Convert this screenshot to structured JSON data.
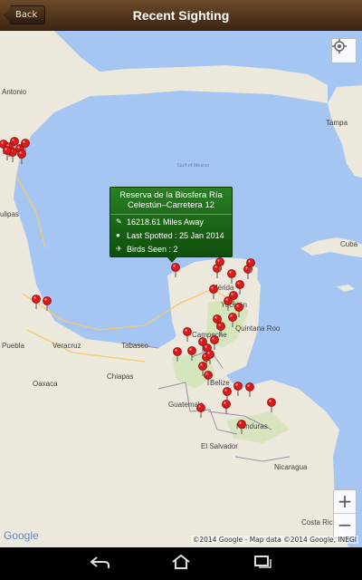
{
  "header": {
    "back_label": "Back",
    "title": "Recent Sighting"
  },
  "info_window": {
    "title": "Reserva de la Biosfera Ría Celestún–Carretera 12",
    "distance": "16218.61 Miles Away",
    "last_spotted": "Last Spotted : 25 Jan 2014",
    "birds_seen": "Birds Seen : 2"
  },
  "map": {
    "labels": {
      "antonio": "Antonio",
      "tampa": "Tampa",
      "gulf": "Gulf of Mexico",
      "ulipas": "ulipas",
      "puebla": "Puebla",
      "veracruz": "Veracruz",
      "tabasco": "Tabasco",
      "oaxaca": "Oaxaca",
      "chiapas": "Chiapas",
      "merida": "Mérida",
      "yucatan": "Yucatán",
      "campeche": "Campeche",
      "quintana": "Quintana Roo",
      "belize": "Belize",
      "guatemala": "Guatemala",
      "honduras": "Honduras",
      "elsalvador": "El Salvador",
      "nicaragua": "Nicaragua",
      "costarica": "Costa Rica",
      "cuba": "Cuba"
    },
    "zoom_in": "+",
    "zoom_out": "−",
    "google": "Google",
    "attribution": "©2014 Google - Map data ©2014 Google, INEGI"
  },
  "nav": {
    "back": "back-icon",
    "home": "home-icon",
    "recents": "recents-icon"
  }
}
